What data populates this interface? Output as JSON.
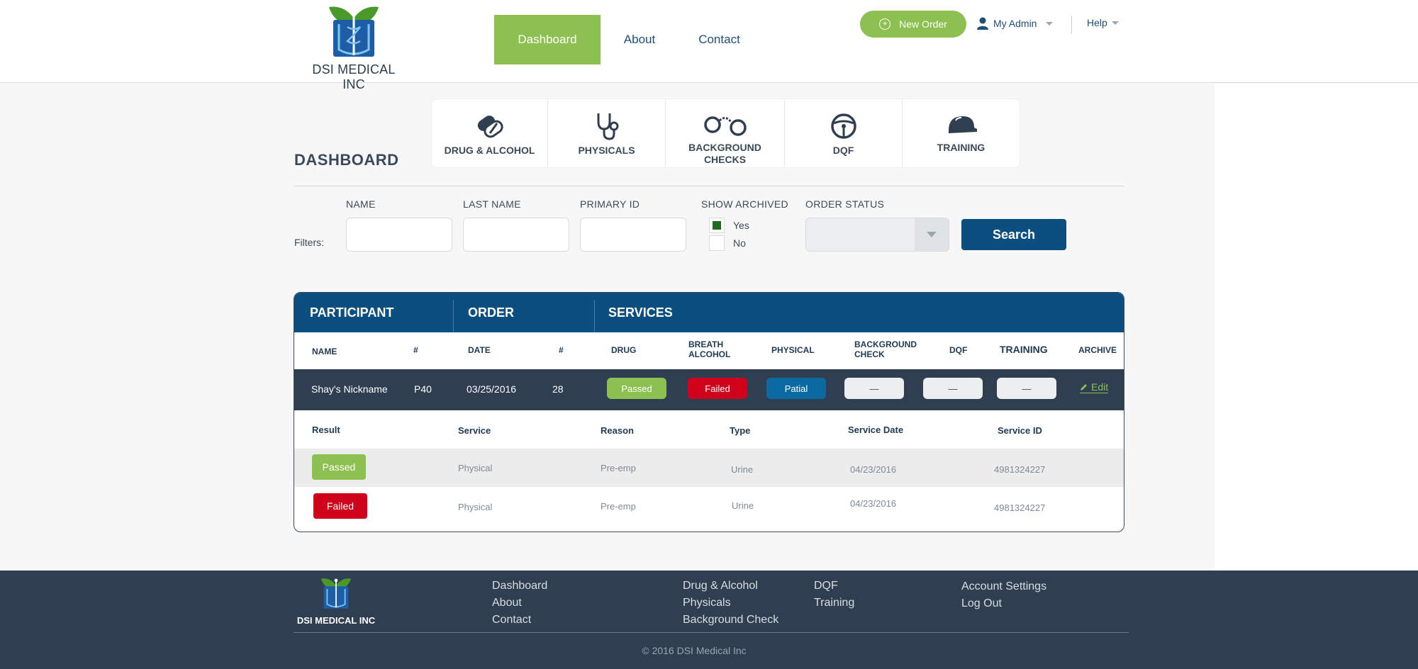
{
  "brand": {
    "name": "DSI MEDICAL INC"
  },
  "nav": {
    "dashboard": "Dashboard",
    "about": "About",
    "contact": "Contact"
  },
  "header": {
    "new_order": "New Order",
    "admin": "My Admin",
    "help": "Help"
  },
  "dashboard": {
    "title": "DASHBOARD"
  },
  "categories": [
    {
      "label": "DRUG & ALCOHOL",
      "icon": "pills-icon"
    },
    {
      "label": "PHYSICALS",
      "icon": "stethoscope-icon"
    },
    {
      "label": "BACKGROUND CHECKS",
      "icon": "handcuffs-icon"
    },
    {
      "label": "DQF",
      "icon": "steering-wheel-icon"
    },
    {
      "label": "TRAINING",
      "icon": "hard-hat-icon"
    }
  ],
  "filters": {
    "label": "Filters:",
    "name": "NAME",
    "last_name": "LAST NAME",
    "primary_id": "PRIMARY ID",
    "show_archived": "SHOW ARCHIVED",
    "yes": "Yes",
    "no": "No",
    "order_status": "ORDER STATUS",
    "search": "Search"
  },
  "table": {
    "groups": {
      "participant": "PARTICIPANT",
      "order": "ORDER",
      "services": "SERVICES"
    },
    "columns": {
      "name": "NAME",
      "num1": "#",
      "date": "DATE",
      "num2": "#",
      "drug": "DRUG",
      "breath": "BREATH ALCOHOL",
      "physical": "PHYSICAL",
      "background": "BACKGROUND CHECK",
      "dqf": "DQF",
      "training": "TRAINING",
      "archive": "ARCHIVE"
    },
    "row": {
      "name": "Shay's Nickname",
      "participant_no": "P40",
      "date": "03/25/2016",
      "order_no": "28",
      "drug": "Passed",
      "breath": "Failed",
      "physical": "Patial",
      "background": "—",
      "dqf": "—",
      "training": "—",
      "edit": "Edit"
    },
    "sub_headers": {
      "result": "Result",
      "service": "Service",
      "reason": "Reason",
      "type": "Type",
      "service_date": "Service Date",
      "service_id": "Service ID"
    },
    "sub_rows": [
      {
        "result": "Passed",
        "service": "Physical",
        "reason": "Pre-emp",
        "type": "Urine",
        "service_date": "04/23/2016",
        "service_id": "4981324227"
      },
      {
        "result": "Failed",
        "service": "Physical",
        "reason": "Pre-emp",
        "type": "Urine",
        "service_date": "04/23/2016",
        "service_id": "4981324227"
      }
    ]
  },
  "footer": {
    "brand": "DSI MEDICAL INC",
    "col1": [
      "Dashboard",
      "About",
      "Contact"
    ],
    "col2": [
      "Drug & Alcohol",
      "Physicals",
      "Background Check"
    ],
    "col3": [
      "DQF",
      "Training"
    ],
    "col4": [
      "Account Settings",
      "Log Out"
    ],
    "copyright": "© 2016 DSI Medical Inc"
  },
  "colors": {
    "green": "#8cc152",
    "navy": "#0b4f80",
    "red": "#d0021b",
    "dark": "#2f3e50"
  }
}
